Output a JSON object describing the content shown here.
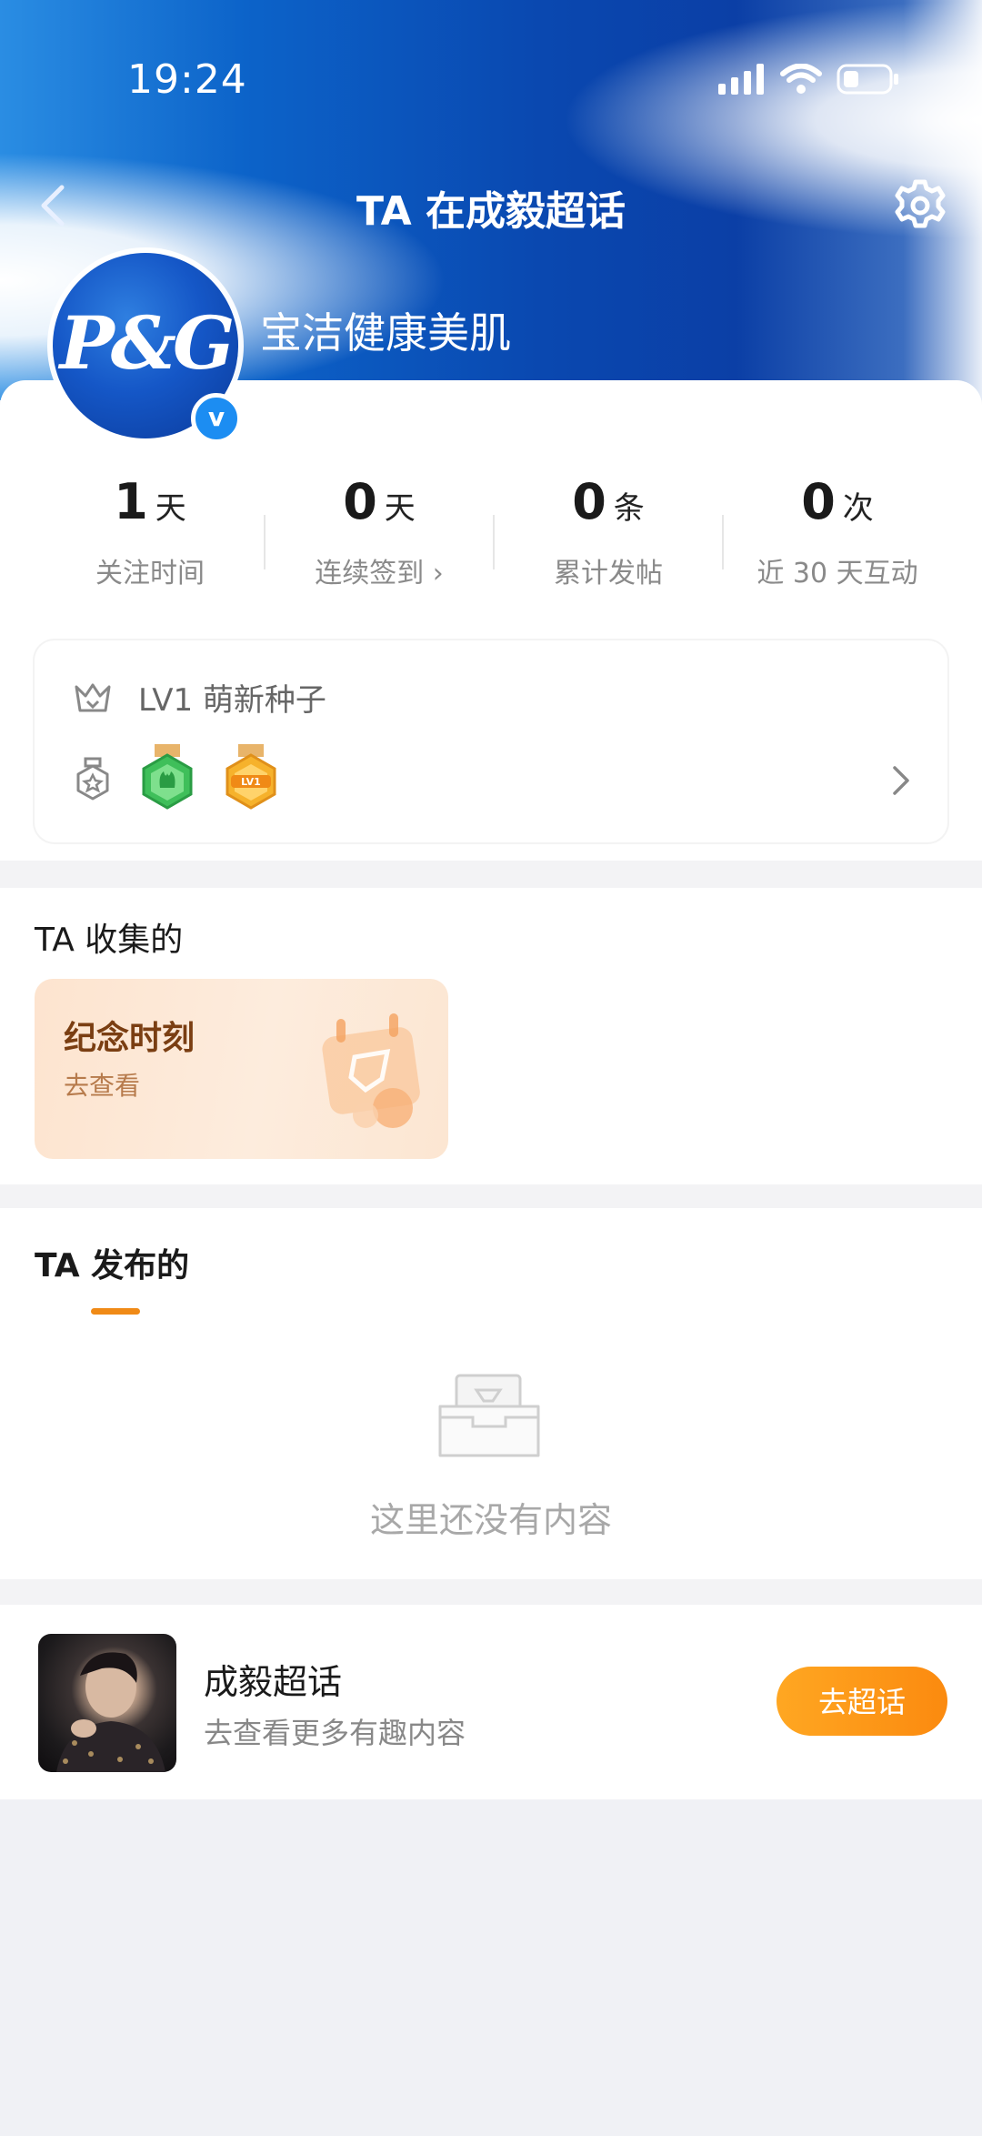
{
  "status_bar": {
    "time": "19:24"
  },
  "nav": {
    "title": "TA 在成毅超话"
  },
  "profile": {
    "logo_text": "P&G",
    "verified_mark": "v",
    "name": "宝洁健康美肌"
  },
  "stats": [
    {
      "value": "1",
      "unit": "天",
      "label": "关注时间"
    },
    {
      "value": "0",
      "unit": "天",
      "label": "连续签到 ›"
    },
    {
      "value": "0",
      "unit": "条",
      "label": "累计发帖"
    },
    {
      "value": "0",
      "unit": "次",
      "label": "近 30 天互动"
    }
  ],
  "level": {
    "text": "LV1 萌新种子",
    "medal_2_text": "LV1"
  },
  "collected": {
    "title": "TA 收集的",
    "card_title": "纪念时刻",
    "card_sub": "去查看"
  },
  "published": {
    "title": "TA 发布的",
    "empty_text": "这里还没有内容"
  },
  "topic": {
    "name": "成毅超话",
    "sub": "去查看更多有趣内容",
    "button": "去超话"
  },
  "colors": {
    "accent": "#f08a16",
    "header_blue": "#0a48b0",
    "verified": "#1c8df2"
  }
}
